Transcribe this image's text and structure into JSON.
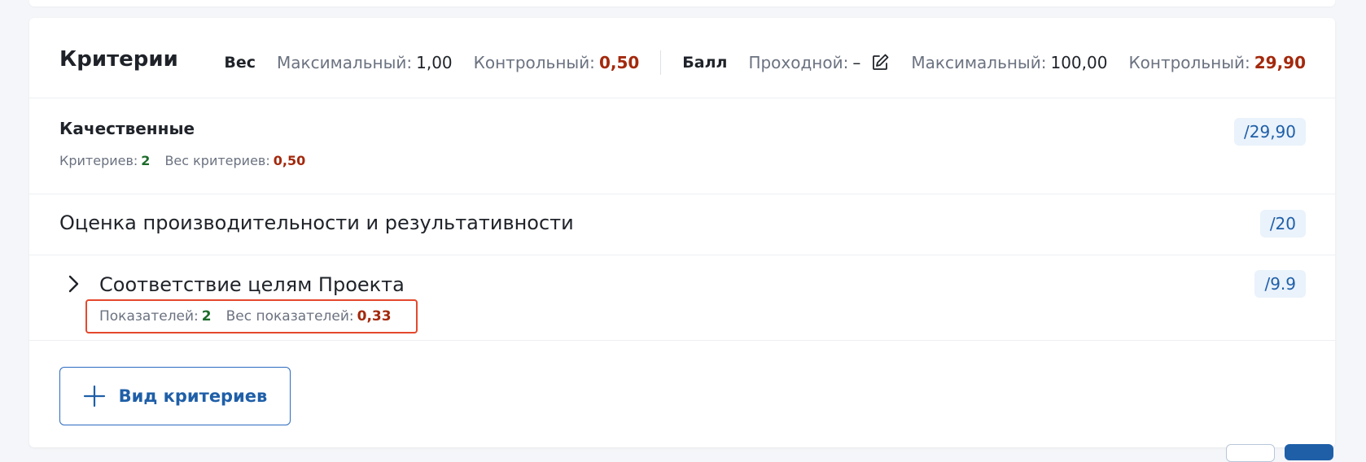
{
  "header": {
    "title": "Критерии",
    "weight": {
      "group_label": "Вес",
      "max_label": "Максимальный:",
      "max_value": "1,00",
      "control_label": "Контрольный:",
      "control_value": "0,50"
    },
    "score": {
      "group_label": "Балл",
      "pass_label": "Проходной:",
      "pass_value": "–",
      "max_label": "Максимальный:",
      "max_value": "100,00",
      "control_label": "Контрольный:",
      "control_value": "29,90"
    }
  },
  "group": {
    "title": "Качественные",
    "count_label": "Критериев:",
    "count_value": "2",
    "weight_label": "Вес критериев:",
    "weight_value": "0,50",
    "score": "/29,90"
  },
  "criterion": {
    "title": "Оценка производительности и результативности",
    "score": "/20"
  },
  "indicator": {
    "title": "Соответствие целям Проекта",
    "score": "/9.9",
    "count_label": "Показателей:",
    "count_value": "2",
    "weight_label": "Вес показателей:",
    "weight_value": "0,33"
  },
  "actions": {
    "add_label": "Вид критериев"
  },
  "icons": {
    "edit": "edit-icon",
    "chevron": "chevron-right-icon",
    "plus": "plus-icon"
  },
  "colors": {
    "accent": "#1f5fa8",
    "red_value": "#a3290d",
    "green_value": "#1c6b2a",
    "highlight_border": "#e4482c"
  }
}
